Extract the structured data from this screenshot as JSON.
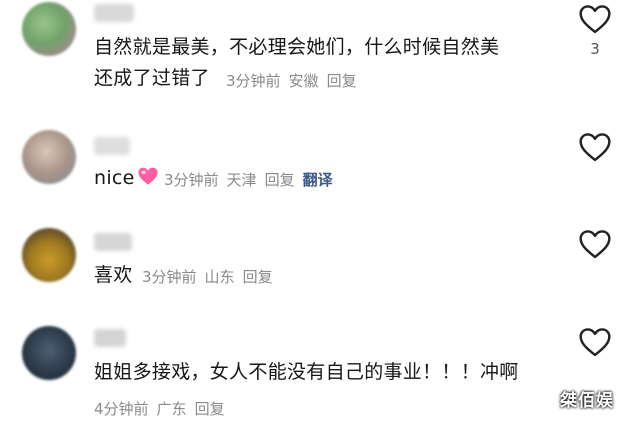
{
  "comments": [
    {
      "content_line1": "自然就是最美，不必理会她们，什么时候自然美",
      "content_line2": "还成了过错了",
      "time": "3分钟前",
      "location": "安徽",
      "reply_label": "回复",
      "like_count": "3"
    },
    {
      "content": "nice",
      "emoji": "pink-heart-emoji",
      "time": "3分钟前",
      "location": "天津",
      "reply_label": "回复",
      "translate_label": "翻译"
    },
    {
      "content": "喜欢",
      "time": "3分钟前",
      "location": "山东",
      "reply_label": "回复"
    },
    {
      "content": "姐姐多接戏，女人不能没有自己的事业！！！冲啊",
      "time": "4分钟前",
      "location": "广东",
      "reply_label": "回复"
    }
  ],
  "watermark": "桀佰娱",
  "icons": {
    "like": "heart-outline-icon",
    "avatar": "blurred-avatar"
  },
  "colors": {
    "text": "#161616",
    "meta": "#8a8a8a",
    "translate": "#3e5a8a",
    "heart_emoji": "#ff5fa2"
  }
}
